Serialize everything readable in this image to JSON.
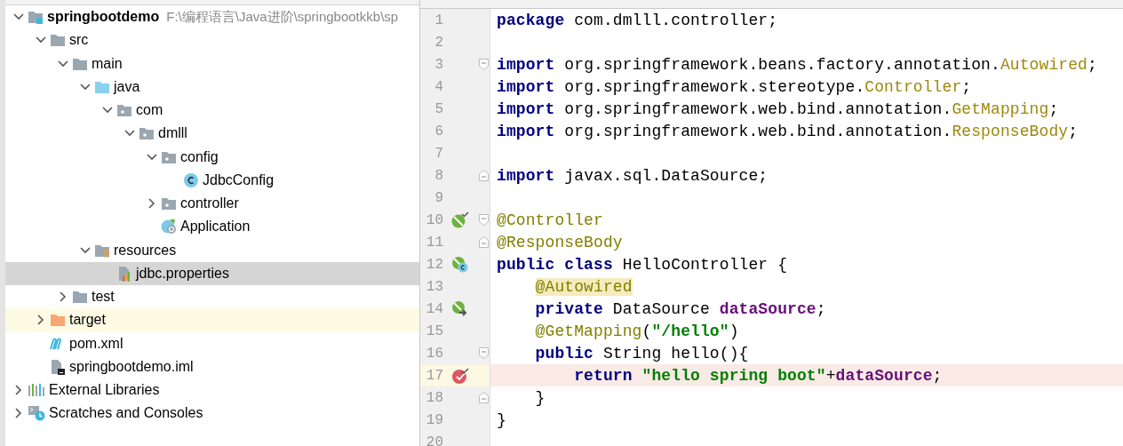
{
  "project_tree": {
    "items": [
      {
        "label": "springbootdemo",
        "path": "F:\\编程语言\\Java进阶\\springbootkkb\\sp",
        "kind": "module",
        "expanded": true,
        "selected": false,
        "highlighted": false,
        "children": [
          {
            "label": "src",
            "kind": "folder",
            "expanded": true,
            "selected": false,
            "highlighted": false,
            "children": [
              {
                "label": "main",
                "kind": "folder",
                "expanded": true,
                "selected": false,
                "highlighted": false,
                "children": [
                  {
                    "label": "java",
                    "kind": "source-folder",
                    "expanded": true,
                    "selected": false,
                    "highlighted": false,
                    "children": [
                      {
                        "label": "com",
                        "kind": "package",
                        "expanded": true,
                        "selected": false,
                        "highlighted": false,
                        "children": [
                          {
                            "label": "dmlll",
                            "kind": "package",
                            "expanded": true,
                            "selected": false,
                            "highlighted": false,
                            "children": [
                              {
                                "label": "config",
                                "kind": "package",
                                "expanded": true,
                                "selected": false,
                                "highlighted": false,
                                "children": [
                                  {
                                    "label": "JdbcConfig",
                                    "kind": "class",
                                    "selected": false,
                                    "highlighted": false
                                  }
                                ]
                              },
                              {
                                "label": "controller",
                                "kind": "package",
                                "expanded": false,
                                "selected": false,
                                "highlighted": false
                              },
                              {
                                "label": "Application",
                                "kind": "spring-app",
                                "selected": false,
                                "highlighted": false
                              }
                            ]
                          }
                        ]
                      }
                    ]
                  },
                  {
                    "label": "resources",
                    "kind": "resource-folder",
                    "expanded": true,
                    "selected": false,
                    "highlighted": false,
                    "children": [
                      {
                        "label": "jdbc.properties",
                        "kind": "properties",
                        "selected": true,
                        "highlighted": false
                      }
                    ]
                  }
                ]
              },
              {
                "label": "test",
                "kind": "folder",
                "expanded": false,
                "selected": false,
                "highlighted": false
              }
            ]
          },
          {
            "label": "target",
            "kind": "excluded-folder",
            "expanded": false,
            "selected": false,
            "highlighted": true
          },
          {
            "label": "pom.xml",
            "kind": "maven",
            "selected": false,
            "highlighted": false
          },
          {
            "label": "springbootdemo.iml",
            "kind": "iml",
            "selected": false,
            "highlighted": false
          }
        ]
      },
      {
        "label": "External Libraries",
        "kind": "libraries",
        "expanded": false,
        "selected": false,
        "highlighted": false
      },
      {
        "label": "Scratches and Consoles",
        "kind": "scratches",
        "expanded": false,
        "selected": false,
        "highlighted": false
      }
    ]
  },
  "editor": {
    "lines": [
      {
        "number": "1",
        "tokens": [
          {
            "text": "package",
            "kind": "keyword"
          },
          {
            "text": " com.dmlll.controller;",
            "kind": "plain"
          }
        ]
      },
      {
        "number": "2"
      },
      {
        "number": "3",
        "fold_marker": {
          "kind": "start"
        },
        "tokens": [
          {
            "text": "import",
            "kind": "keyword"
          },
          {
            "text": " org.springframework.beans.factory.annotation.",
            "kind": "plain"
          },
          {
            "text": "Autowired",
            "kind": "annotation-ref"
          },
          {
            "text": ";",
            "kind": "plain"
          }
        ]
      },
      {
        "number": "4",
        "tokens": [
          {
            "text": "import",
            "kind": "keyword"
          },
          {
            "text": " org.springframework.stereotype.",
            "kind": "plain"
          },
          {
            "text": "Controller",
            "kind": "annotation-ref"
          },
          {
            "text": ";",
            "kind": "plain"
          }
        ]
      },
      {
        "number": "5",
        "tokens": [
          {
            "text": "import",
            "kind": "keyword"
          },
          {
            "text": " org.springframework.web.bind.annotation.",
            "kind": "plain"
          },
          {
            "text": "GetMapping",
            "kind": "annotation-ref"
          },
          {
            "text": ";",
            "kind": "plain"
          }
        ]
      },
      {
        "number": "6",
        "tokens": [
          {
            "text": "import",
            "kind": "keyword"
          },
          {
            "text": " org.springframework.web.bind.annotation.",
            "kind": "plain"
          },
          {
            "text": "ResponseBody",
            "kind": "annotation-ref"
          },
          {
            "text": ";",
            "kind": "plain"
          }
        ]
      },
      {
        "number": "7"
      },
      {
        "number": "8",
        "fold_marker": {
          "kind": "end"
        },
        "tokens": [
          {
            "text": "import",
            "kind": "keyword"
          },
          {
            "text": " javax.sql.DataSource;",
            "kind": "plain"
          }
        ]
      },
      {
        "number": "9"
      },
      {
        "number": "10",
        "fold_marker": {
          "kind": "start"
        },
        "gutter_icon": {
          "kind": "bean"
        },
        "tokens": [
          {
            "text": "@Controller",
            "kind": "annotation"
          }
        ]
      },
      {
        "number": "11",
        "fold_marker": {
          "kind": "end"
        },
        "tokens": [
          {
            "text": "@ResponseBody",
            "kind": "annotation"
          }
        ]
      },
      {
        "number": "12",
        "gutter_icon": {
          "kind": "class-bean"
        },
        "tokens": [
          {
            "text": "public class",
            "kind": "keyword"
          },
          {
            "text": " HelloController {",
            "kind": "plain"
          }
        ],
        "children": [
          {
            "number": "13",
            "tokens": [
              {
                "text": "@Autowired",
                "kind": "annotation",
                "highlighted": true
              }
            ]
          },
          {
            "number": "14",
            "gutter_icon": {
              "kind": "injected"
            },
            "tokens": [
              {
                "text": "private",
                "kind": "keyword"
              },
              {
                "text": " DataSource ",
                "kind": "plain"
              },
              {
                "text": "dataSource",
                "kind": "field"
              },
              {
                "text": ";",
                "kind": "plain"
              }
            ]
          },
          {
            "number": "15",
            "tokens": [
              {
                "text": "@GetMapping",
                "kind": "annotation"
              },
              {
                "text": "(",
                "kind": "plain"
              },
              {
                "text": "\"/hello\"",
                "kind": "string"
              },
              {
                "text": ")",
                "kind": "plain"
              }
            ]
          },
          {
            "number": "16",
            "fold_marker": {
              "kind": "start"
            },
            "tokens": [
              {
                "text": "public",
                "kind": "keyword"
              },
              {
                "text": " String hello(){",
                "kind": "plain"
              }
            ],
            "children": [
              {
                "number": "17",
                "breakpoint": true,
                "gutter_icon": {
                  "kind": "breakpoint"
                },
                "tokens": [
                  {
                    "text": "return",
                    "kind": "keyword"
                  },
                  {
                    "text": " \"hello spring boot\"",
                    "kind": "string"
                  },
                  {
                    "text": "+",
                    "kind": "plain"
                  },
                  {
                    "text": "dataSource",
                    "kind": "field"
                  },
                  {
                    "text": ";",
                    "kind": "plain"
                  }
                ]
              }
            ]
          },
          {
            "number": "18",
            "fold_marker": {
              "kind": "end"
            },
            "tokens": [
              {
                "text": "}",
                "kind": "plain"
              }
            ]
          }
        ]
      },
      {
        "number": "19",
        "tokens": [
          {
            "text": "}",
            "kind": "plain"
          }
        ]
      },
      {
        "number": "20"
      }
    ]
  }
}
